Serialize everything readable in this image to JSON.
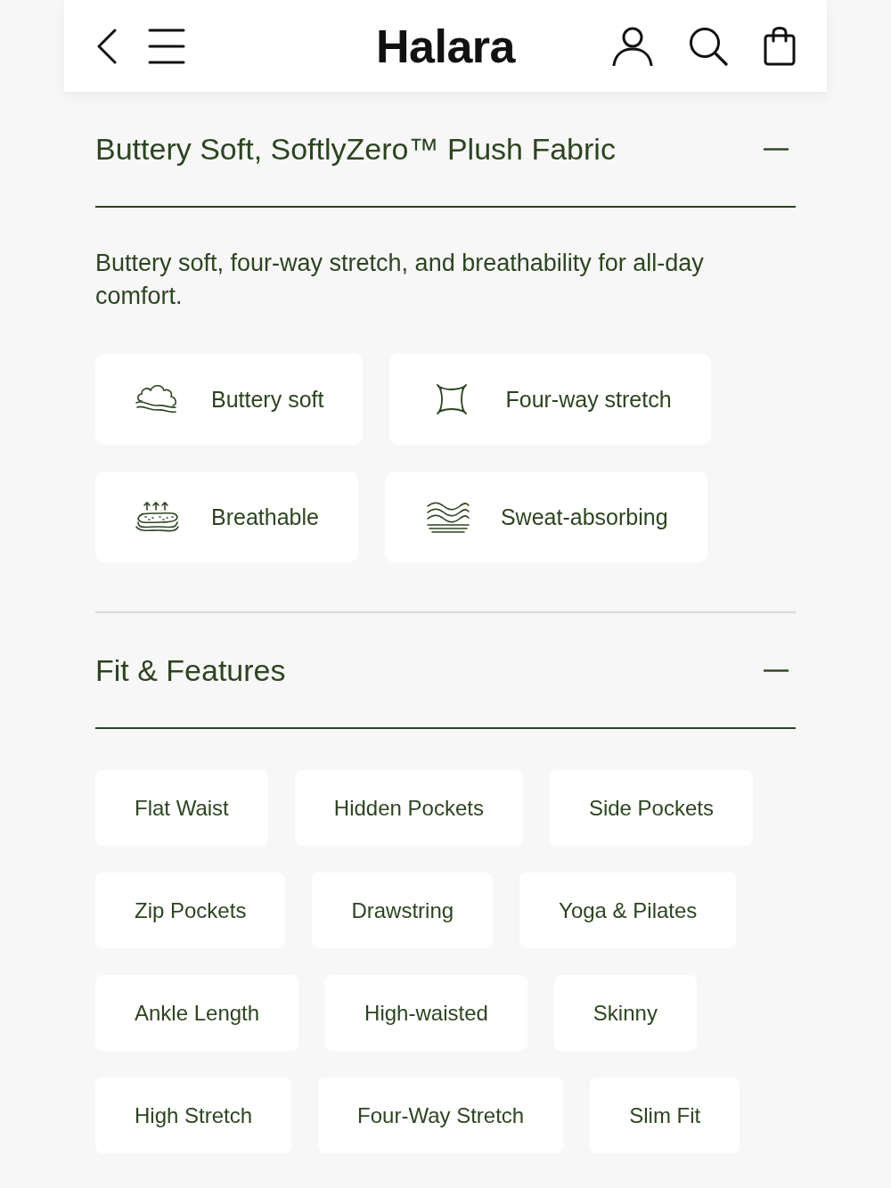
{
  "header": {
    "logo": "Halara"
  },
  "fabric": {
    "title": "Buttery Soft, SoftlyZero™ Plush Fabric",
    "expanded": true,
    "description": "Buttery soft, four-way stretch, and breathability for all-day comfort.",
    "features": [
      {
        "label": "Buttery soft"
      },
      {
        "label": "Four-way stretch"
      },
      {
        "label": "Breathable"
      },
      {
        "label": "Sweat-absorbing"
      }
    ]
  },
  "fit_features": {
    "title": "Fit & Features",
    "expanded": true,
    "tags": [
      "Flat Waist",
      "Hidden Pockets",
      "Side Pockets",
      "Zip Pockets",
      "Drawstring",
      "Yoga & Pilates",
      "Ankle Length",
      "High-waisted",
      "Skinny",
      "High Stretch",
      "Four-Way Stretch",
      "Slim Fit"
    ]
  }
}
